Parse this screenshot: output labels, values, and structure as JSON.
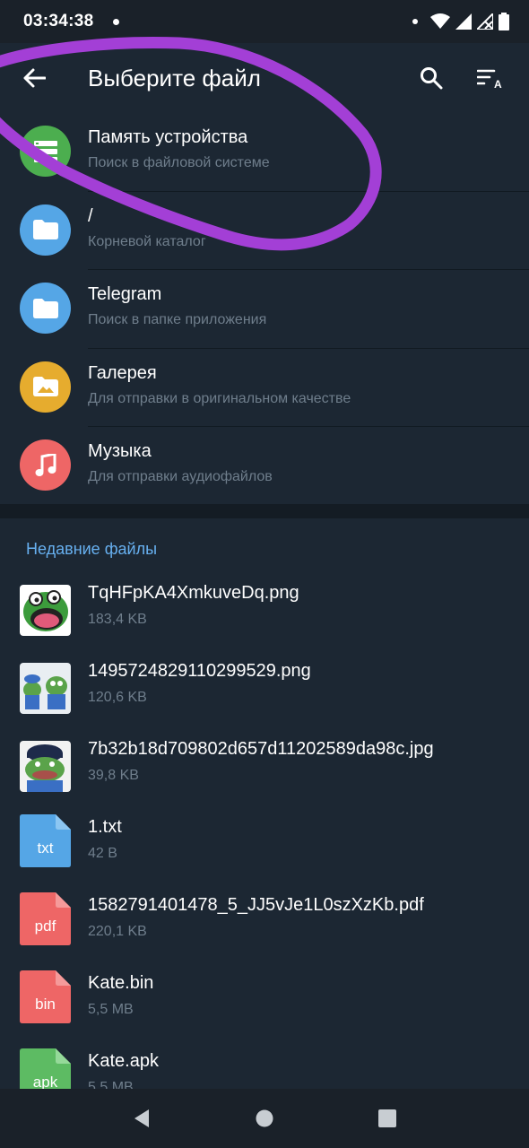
{
  "status_bar": {
    "time": "03:34:38"
  },
  "app_bar": {
    "title": "Выберите файл",
    "back_icon": "arrow-left-icon",
    "search_icon": "search-icon",
    "sort_icon": "sort-alpha-icon"
  },
  "locations": [
    {
      "title": "Память устройства",
      "subtitle": "Поиск в файловой системе",
      "icon": "storage-icon",
      "color": "#4cae4f"
    },
    {
      "title": "/",
      "subtitle": "Корневой каталог",
      "icon": "folder-icon",
      "color": "#55a6e6"
    },
    {
      "title": "Telegram",
      "subtitle": "Поиск в папке приложения",
      "icon": "folder-icon",
      "color": "#55a6e6"
    },
    {
      "title": "Галерея",
      "subtitle": "Для отправки в оригинальном качестве",
      "icon": "image-icon",
      "color": "#e6ac2e"
    },
    {
      "title": "Музыка",
      "subtitle": "Для отправки аудиофайлов",
      "icon": "music-note-icon",
      "color": "#ee6666"
    }
  ],
  "recent": {
    "header": "Недавние файлы",
    "files": [
      {
        "name": "TqHFpKA4XmkuveDq.png",
        "size": "183,4 KB",
        "thumb": "image-thumbnail"
      },
      {
        "name": "1495724829110299529.png",
        "size": "120,6 KB",
        "thumb": "image-thumbnail"
      },
      {
        "name": "7b32b18d709802d657d11202589da98c.jpg",
        "size": "39,8 KB",
        "thumb": "image-thumbnail"
      },
      {
        "name": "1.txt",
        "size": "42 B",
        "ext": "txt",
        "color": "#55a6e6"
      },
      {
        "name": "1582791401478_5_JJ5vJe1L0szXzKb.pdf",
        "size": "220,1 KB",
        "ext": "pdf",
        "color": "#ee6666"
      },
      {
        "name": "Kate.bin",
        "size": "5,5 MB",
        "ext": "bin",
        "color": "#ee6666"
      },
      {
        "name": "Kate.apk",
        "size": "5,5 MB",
        "ext": "apk",
        "color": "#5dbb63"
      }
    ]
  },
  "annotation": {
    "color": "#a33fd6"
  },
  "colors": {
    "background": "#1c2733",
    "accent": "#67b0f0",
    "subtitle": "#6f7e8c"
  }
}
